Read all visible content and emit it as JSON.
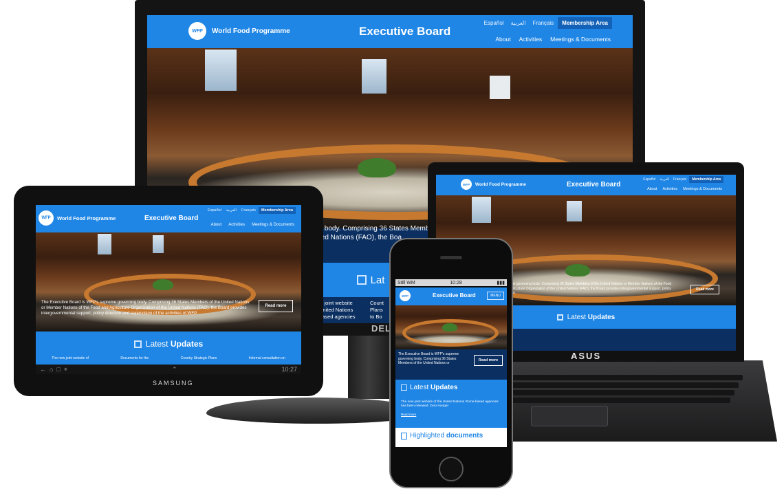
{
  "site": {
    "logo_text": "World Food Programme",
    "logo_mark": "WFP",
    "board_title": "Executive Board",
    "languages": [
      "Español",
      "العربية",
      "Français"
    ],
    "membership": "Membership Area",
    "nav": [
      "About",
      "Activities",
      "Meetings & Documents"
    ],
    "hero_caption": "The Executive Board is WFP's supreme governing body. Comprising 36 States Members of the United Nations or Member Nations of the Food and Agriculture Organization of the United Nations (FAO), the Board provides intergovernmental support, policy direction and supervision of the activities of WFP.",
    "read_more": "Read more",
    "updates_light": "Latest",
    "updates_bold": "Updates",
    "highlighted_light": "Highlighted",
    "highlighted_bold": "documents",
    "menu": "MENU"
  },
  "monitor": {
    "brand": "DELL",
    "caption_fragment_1": "y body. Comprising 36 States Member",
    "caption_fragment_2": "ted Nations (FAO), the Boa",
    "updates_fragment": "Lat",
    "update_col_1": "w joint website",
    "update_col_1b": "United Nations",
    "update_col_1c": "based agencies",
    "update_col_2": "Count",
    "update_col_2b": "Plans",
    "update_col_2c": "to Bo"
  },
  "laptop": {
    "brand": "ASUS",
    "caption": "supreme governing body. Comprising 36 States Members of the United Nations or Member Nations of the Food and Agriculture Organization of the United Nations (FAO), the Board provides intergovernmental support, policy direction"
  },
  "tablet": {
    "brand": "SAMSUNG",
    "update_cols": [
      "The new joint website of",
      "Documents for the",
      "Country Strategic Plans",
      "Informal consultation on"
    ],
    "clock": "10:27"
  },
  "phone": {
    "carrier": "Still WM",
    "time": "10:28",
    "caption": "The Executive Board is WFP's supreme governing body. Comprising 36 States Members of the United Nations or",
    "update_text": "The new joint website of the United Nations Rome-based agencies has been released: Zero Hunger",
    "update_link": "Read more"
  },
  "colors": {
    "brand_blue": "#1f86e6",
    "dark_navy": "#0b2f60"
  }
}
